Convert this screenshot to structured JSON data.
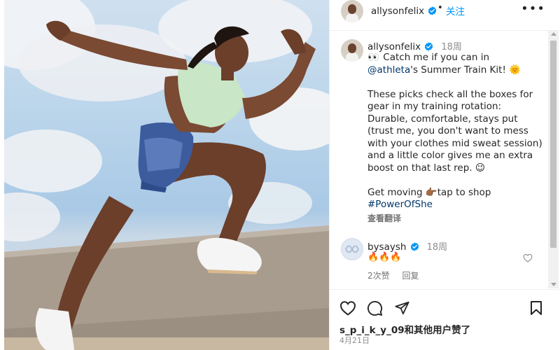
{
  "post": {
    "username": "allysonfelix",
    "follow_label": "关注",
    "separator": "•",
    "more_label": "•••",
    "caption_time": "18周",
    "caption_line1_emoji": "👀",
    "caption_line1_a": " Catch me if you can in ",
    "caption_mention": "@athleta",
    "caption_line1_b": "'s Summer Train Kit! ",
    "caption_line1_sun": "🌞",
    "caption_para2": "These picks check all the boxes for gear in my training rotation: Durable, comfortable, stays put (trust me, you don't want to mess with your clothes mid sweat session) and a little color gives me an extra boost on that last rep. ",
    "caption_para2_emoji": "😉",
    "caption_para3": "Get moving ",
    "caption_para3_emoji": "👉🏾",
    "caption_para3_b": "tap to shop",
    "caption_hashtag": "#PowerOfShe",
    "translate_label": "查看翻译"
  },
  "comment": {
    "username": "bysaysh",
    "time": "18周",
    "text": "🔥🔥🔥",
    "likes_label": "2次赞",
    "reply_label": "回复"
  },
  "footer": {
    "likes_text": "s_p_i_k_y_09和其他用户赞了",
    "date": "4月21日"
  },
  "icons": {
    "like": "heart-icon",
    "comment": "comment-icon",
    "share": "send-icon",
    "save": "bookmark-icon",
    "verified": "verified-badge-icon",
    "more": "more-options-icon"
  },
  "colors": {
    "verified": "#0095f6",
    "follow": "#0095f6",
    "link": "#00376b",
    "muted": "#8e8e8e"
  }
}
